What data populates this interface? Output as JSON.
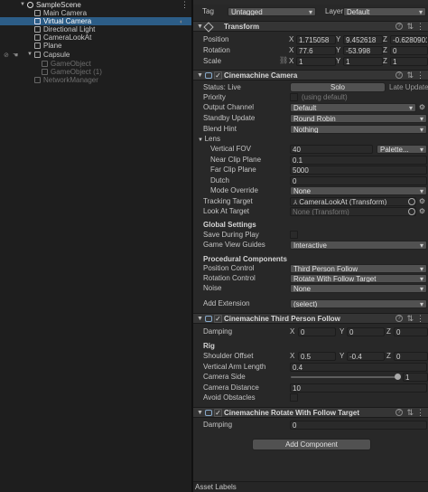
{
  "hierarchy": {
    "scene": "SampleScene",
    "items": [
      "Main Camera",
      "Virtual Camera",
      "Directional Light",
      "CameraLookAt",
      "Plane",
      "Capsule",
      "GameObject",
      "GameObject (1)",
      "NetworkManager"
    ]
  },
  "inspector": {
    "object_name": "Virtual Camera",
    "tag_label": "Tag",
    "tag_value": "Untagged",
    "layer_label": "Layer",
    "layer_value": "Default",
    "transform": {
      "title": "Transform",
      "position_label": "Position",
      "rotation_label": "Rotation",
      "scale_label": "Scale",
      "axes": [
        "X",
        "Y",
        "Z"
      ],
      "position": [
        "1.715058",
        "9.452618",
        "-0.6280901"
      ],
      "rotation": [
        "77.6",
        "-53.998",
        "0"
      ],
      "scale": [
        "1",
        "1",
        "1"
      ]
    },
    "cinemachine_camera": {
      "title": "Cinemachine Camera",
      "status_label": "Status: Live",
      "solo_label": "Solo",
      "late_update": "Late Update",
      "priority_label": "Priority",
      "priority_hint": "(using default)",
      "output_channel_label": "Output Channel",
      "output_channel_value": "Default",
      "standby_label": "Standby Update",
      "standby_value": "Round Robin",
      "blend_label": "Blend Hint",
      "blend_value": "Nothing",
      "lens_label": "Lens",
      "vfov_label": "Vertical FOV",
      "vfov_value": "40",
      "vfov_preset": "Palette...",
      "near_label": "Near Clip Plane",
      "near_value": "0.1",
      "far_label": "Far Clip Plane",
      "far_value": "5000",
      "dutch_label": "Dutch",
      "dutch_value": "0",
      "mode_label": "Mode Override",
      "mode_value": "None",
      "tracking_label": "Tracking Target",
      "tracking_value": "CameraLookAt (Transform)",
      "lookat_label": "Look At Target",
      "lookat_value": "None (Transform)",
      "global_settings": "Global Settings",
      "save_play_label": "Save During Play",
      "guides_label": "Game View Guides",
      "guides_value": "Interactive",
      "procedural": "Procedural Components",
      "pos_ctrl_label": "Position Control",
      "pos_ctrl_value": "Third Person Follow",
      "rot_ctrl_label": "Rotation Control",
      "rot_ctrl_value": "Rotate With Follow Target",
      "noise_label": "Noise",
      "noise_value": "None",
      "ext_label": "Add Extension",
      "ext_value": "(select)"
    },
    "third_person": {
      "title": "Cinemachine Third Person Follow",
      "damping_label": "Damping",
      "damping": [
        "0",
        "0",
        "0"
      ],
      "rig_label": "Rig",
      "shoulder_label": "Shoulder Offset",
      "shoulder": [
        "0.5",
        "-0.4",
        "0"
      ],
      "arm_label": "Vertical Arm Length",
      "arm_value": "0.4",
      "side_label": "Camera Side",
      "side_value": "1",
      "distance_label": "Camera Distance",
      "distance_value": "10",
      "avoid_label": "Avoid Obstacles"
    },
    "rotate_follow": {
      "title": "Cinemachine Rotate With Follow Target",
      "damping_label": "Damping",
      "damping_value": "0"
    },
    "add_component": "Add Component",
    "footer": "Asset Labels"
  }
}
